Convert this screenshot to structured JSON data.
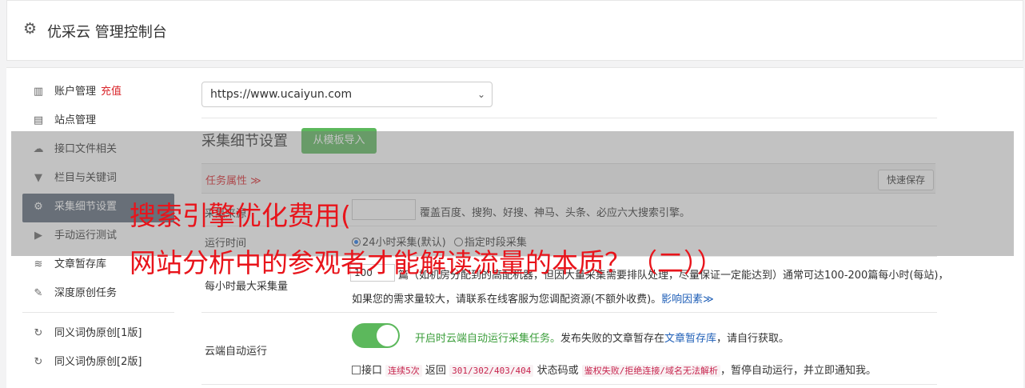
{
  "header": {
    "title": "优采云 管理控制台"
  },
  "sidebar": {
    "items": [
      {
        "label": "账户管理",
        "extra": "充值",
        "icon": "bar-chart-icon"
      },
      {
        "label": "站点管理",
        "icon": "server-icon"
      },
      {
        "label": "接口文件相关",
        "icon": "cloud-upload-icon"
      },
      {
        "label": "栏目与关键词",
        "icon": "filter-icon"
      },
      {
        "label": "采集细节设置",
        "icon": "gears-icon",
        "active": true
      },
      {
        "label": "手动运行测试",
        "icon": "play-circle-icon"
      },
      {
        "label": "文章暂存库",
        "icon": "database-icon"
      },
      {
        "label": "深度原创任务",
        "icon": "edit-icon"
      }
    ],
    "items2": [
      {
        "label": "同义词伪原创[1版]",
        "icon": "refresh-icon"
      },
      {
        "label": "同义词伪原创[2版]",
        "icon": "refresh-icon"
      }
    ]
  },
  "site_select": {
    "value": "https://www.ucaiyun.com"
  },
  "section": {
    "title": "采集细节设置",
    "import_button": "从模板导入"
  },
  "task": {
    "attr_label": "任务属性 ≫",
    "save_button": "快速保存"
  },
  "engines": {
    "label": "采集来源",
    "desc": "覆盖百度、搜狗、好搜、神马、头条、必应六大搜索引擎。"
  },
  "run_time": {
    "label": "运行时间",
    "option1": "24小时采集(默认)",
    "option2": "指定时段采集"
  },
  "max_per_hour": {
    "label": "每小时最大采集量",
    "value": "100",
    "line1_prefix": "篇",
    "line1": "（如机房分配到的高配机器，但因大量采集需要排队处理，尽量保证一定能达到）通常可达100-200篇每小时(每站)，",
    "line2": "如果您的需求量较大，请联系在线客服为您调配资源(不额外收费)。",
    "link": "影响因素≫"
  },
  "cloud_run": {
    "label": "云端自动运行",
    "enabled_text": "开启时云端自动运行采集任务。",
    "text2": "发布失败的文章暂存在",
    "link": "文章暂存库",
    "text3": "，请自行获取。",
    "opt_prefix": "接口",
    "code1": "连续5次",
    "opt_mid1": "返回",
    "code2": "301/302/403/404",
    "opt_mid2": "状态码或",
    "code3": "鉴权失败/拒绝连接/域名无法解析",
    "opt_end": "，暂停自动运行，并立即通知我。"
  },
  "overlay": {
    "line1": "搜索引擎优化费用(",
    "line2": "网站分析中的参观者才能解读流量的本质？（二））"
  },
  "colors": {
    "accent_green": "#5cb85c",
    "active_nav": "#5b6979",
    "alert_red": "#d9252b",
    "link_blue": "#1f5fb7"
  }
}
